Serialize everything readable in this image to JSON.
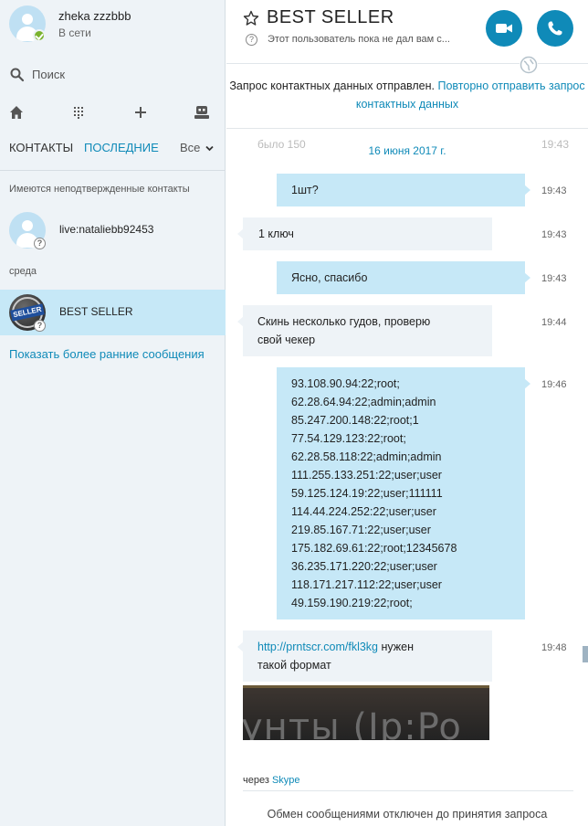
{
  "me": {
    "name": "zheka zzzbbb",
    "status": "В сети"
  },
  "search": {
    "label": "Поиск"
  },
  "toolbar": {
    "home": "home-icon",
    "dialpad": "dialpad-icon",
    "add": "add-icon",
    "bot": "bot-icon"
  },
  "tabs": {
    "contacts": "КОНТАКТЫ",
    "recent": "ПОСЛЕДНИЕ",
    "filter": "Все"
  },
  "sidebar": {
    "unconfirmed_label": "Имеются неподтвержденные контакты",
    "unconfirmed_contact": "live:nataliebb92453",
    "day_label": "среда",
    "selected_contact": "BEST SELLER",
    "selected_avatar_text": "SELLER",
    "show_earlier": "Показать более ранние сообщения"
  },
  "header": {
    "title": "BEST SELLER",
    "subtitle": "Этот пользователь пока не дал вам с...",
    "accent": "#0f8ab8"
  },
  "notice": {
    "text": "Запрос контактных данных отправлен.",
    "link": "Повторно отправить запрос контактных данных"
  },
  "chat": {
    "ghost_left": "было 150",
    "ghost_right": "19:43",
    "date": "16 июня 2017 г.",
    "messages": [
      {
        "dir": "out",
        "text": "1шт?",
        "time": "19:43"
      },
      {
        "dir": "in",
        "text": "1 ключ",
        "time": "19:43"
      },
      {
        "dir": "out",
        "text": "Ясно, спасибо",
        "time": "19:43"
      },
      {
        "dir": "in",
        "lines": [
          "Скинь несколько гудов, проверю",
          "свой чекер"
        ],
        "time": "19:44"
      },
      {
        "dir": "out",
        "lines": [
          "93.108.90.94:22;root;",
          "62.28.64.94:22;admin;admin",
          "85.247.200.148:22;root;1",
          "77.54.129.123:22;root;",
          "62.28.58.118:22;admin;admin",
          "111.255.133.251:22;user;user",
          "59.125.124.19:22;user;111111",
          "114.44.224.252:22;user;user",
          "219.85.167.71:22;user;user",
          "175.182.69.61:22;root;12345678",
          "36.235.171.220:22;user;user",
          "118.171.217.112:22;user;user",
          "49.159.190.219:22;root;"
        ],
        "time": "19:46"
      },
      {
        "dir": "in",
        "link": "http://prntscr.com/fkl3kg",
        "after_link": " нужен",
        "line2": "такой формат",
        "time": "19:48"
      }
    ],
    "preview_text": "унты (Ip:Po"
  },
  "footer": {
    "via_prefix": "через",
    "via_link": "Skype",
    "disabled_text": "Обмен сообщениями отключен до принятия запроса"
  }
}
